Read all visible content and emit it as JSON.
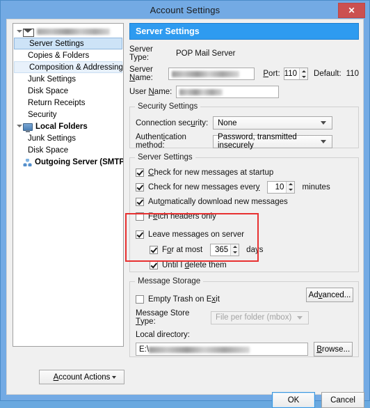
{
  "window": {
    "title": "Account Settings",
    "close_label": "✕",
    "frame_color": "#73aae4",
    "accent_color": "#2e9bf0",
    "close_color": "#cb5050"
  },
  "sidebar": {
    "account_node": {
      "label": "",
      "redacted": true,
      "icon": "mail-icon"
    },
    "items": [
      {
        "label": "Server Settings",
        "state": "selected",
        "level": "child"
      },
      {
        "label": "Copies & Folders",
        "state": "normal",
        "level": "child"
      },
      {
        "label": "Composition & Addressing",
        "state": "soft",
        "level": "child"
      },
      {
        "label": "Junk Settings",
        "state": "normal",
        "level": "child"
      },
      {
        "label": "Disk Space",
        "state": "normal",
        "level": "child"
      },
      {
        "label": "Return Receipts",
        "state": "normal",
        "level": "child"
      },
      {
        "label": "Security",
        "state": "normal",
        "level": "child"
      }
    ],
    "local_folders": {
      "label": "Local Folders",
      "icon": "computer-icon",
      "items": [
        {
          "label": "Junk Settings"
        },
        {
          "label": "Disk Space"
        }
      ]
    },
    "outgoing_server": {
      "label": "Outgoing Server (SMTP)",
      "icon": "network-icon"
    },
    "account_actions": {
      "label": "Account Actions",
      "accel": "A"
    }
  },
  "main": {
    "panel_title": "Server Settings",
    "server_type": {
      "label": "Server Type:",
      "value": "POP Mail Server"
    },
    "server_name": {
      "label": "Server Name:",
      "value": "",
      "redacted": true
    },
    "port": {
      "label": "Port:",
      "value": "110"
    },
    "default_port": {
      "label": "Default:",
      "value": "110"
    },
    "user_name": {
      "label": "User Name:",
      "value": "",
      "redacted": true
    },
    "security_settings": {
      "title": "Security Settings",
      "connection_security": {
        "label": "Connection security:",
        "value": "None"
      },
      "auth_method": {
        "label": "Authentication method:",
        "value": "Password, transmitted insecurely"
      }
    },
    "server_settings": {
      "title": "Server Settings",
      "check_startup": {
        "label": "Check for new messages at startup",
        "checked": true
      },
      "check_every": {
        "label": "Check for new messages every",
        "checked": true,
        "value": "10",
        "unit": "minutes"
      },
      "auto_download": {
        "label": "Automatically download new messages",
        "checked": true
      },
      "fetch_headers": {
        "label": "Fetch headers only",
        "checked": false
      },
      "leave_on_server": {
        "label": "Leave messages on server",
        "checked": true,
        "highlighted": true
      },
      "for_at_most": {
        "label": "For at most",
        "checked": true,
        "value": "365",
        "unit": "days"
      },
      "until_delete": {
        "label": "Until I delete them",
        "checked": true
      }
    },
    "message_storage": {
      "title": "Message Storage",
      "empty_trash": {
        "label": "Empty Trash on Exit",
        "checked": false
      },
      "advanced_button": "Advanced...",
      "store_type": {
        "label": "Message Store Type:",
        "value": "File per folder (mbox)",
        "disabled": true
      },
      "local_directory": {
        "label": "Local directory:",
        "value": "E:\\",
        "redacted": true
      },
      "browse_button": "Browse..."
    }
  },
  "footer": {
    "ok_label": "OK",
    "cancel_label": "Cancel"
  },
  "highlight": {
    "color": "#e83030"
  }
}
